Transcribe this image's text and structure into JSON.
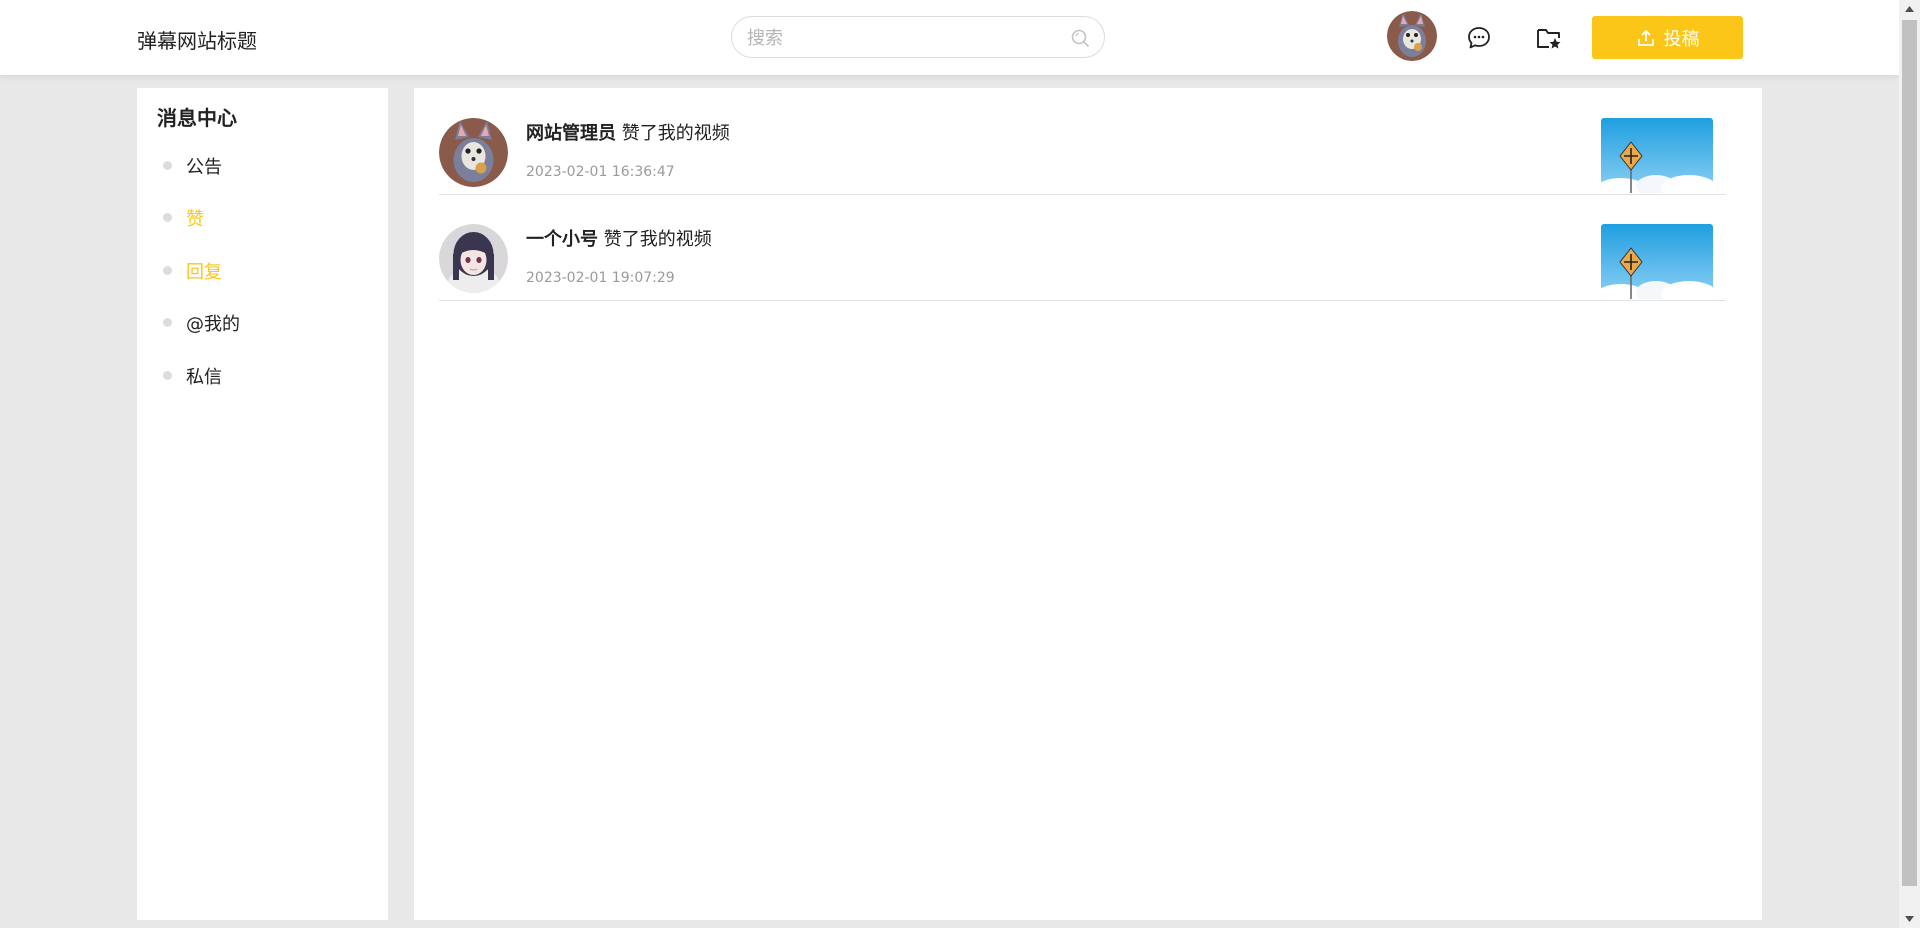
{
  "header": {
    "title": "弹幕网站标题",
    "search_placeholder": "搜索",
    "upload_label": "投稿"
  },
  "sidebar": {
    "title": "消息中心",
    "items": [
      {
        "label": "公告"
      },
      {
        "label": "赞"
      },
      {
        "label": "回复"
      },
      {
        "label": "@我的"
      },
      {
        "label": "私信"
      }
    ]
  },
  "messages": [
    {
      "user": "网站管理员",
      "action": "赞了我的视频",
      "time": "2023-02-01 16:36:47"
    },
    {
      "user": "一个小号",
      "action": "赞了我的视频",
      "time": "2023-02-01 19:07:29"
    }
  ],
  "colors": {
    "accent": "#fbc617",
    "background": "#e8e8e8",
    "divider": "#e2e2e2"
  },
  "icons": {
    "search": "search-icon",
    "message": "chat-bubble-icon",
    "favorites": "folder-star-icon",
    "upload": "upload-icon"
  }
}
